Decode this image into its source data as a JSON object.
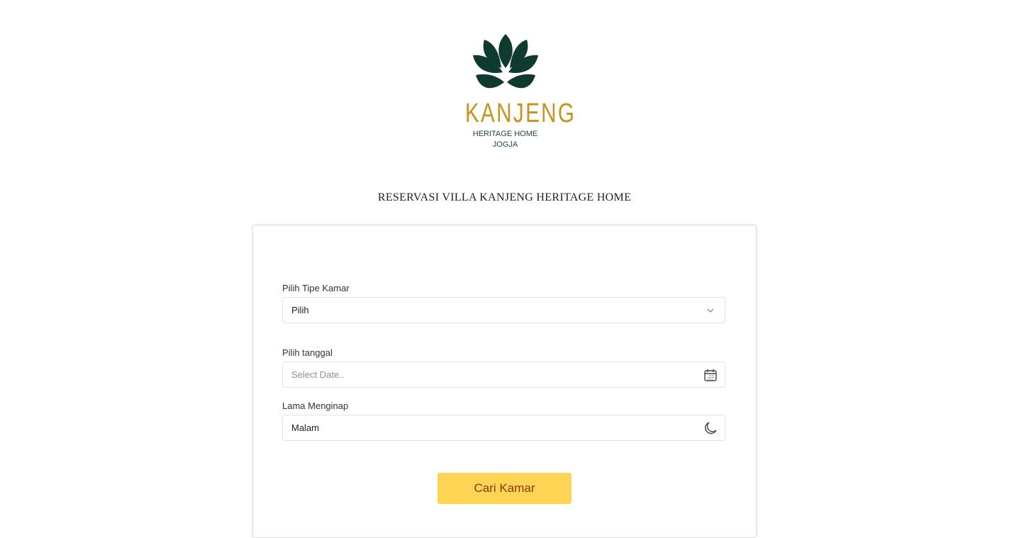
{
  "logo": {
    "brand": "KANJENG",
    "line1": "HERITAGE HOME",
    "line2": "JOGJA"
  },
  "page_title": "RESERVASI VILLA KANJENG HERITAGE HOME",
  "form": {
    "room_type": {
      "label": "Pilih Tipe Kamar",
      "value": "Pilih",
      "icon": "chevron-down-icon"
    },
    "date": {
      "label": "Pilih tanggal",
      "placeholder": "Select Date..",
      "icon": "calendar-icon"
    },
    "nights": {
      "label": "Lama Menginap",
      "value": "Malam",
      "icon": "moon-icon"
    },
    "submit_label": "Cari Kamar"
  },
  "colors": {
    "brand_gold": "#c8931a",
    "brand_green": "#0f3a2f",
    "button": "#fdd453"
  }
}
